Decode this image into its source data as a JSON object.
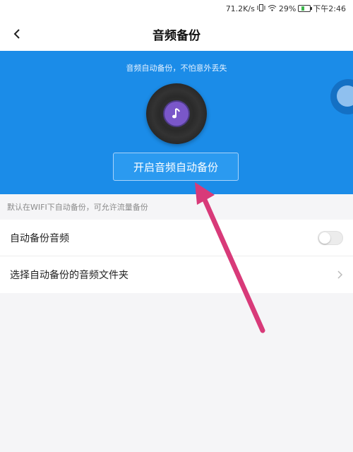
{
  "status_bar": {
    "speed": "71.2K/s",
    "battery_percent": "29%",
    "battery_level": 0.29,
    "time": "下午2:46"
  },
  "header": {
    "title": "音频备份"
  },
  "hero": {
    "subtitle": "音频自动备份，不怕意外丢失",
    "start_button_label": "开启音频自动备份"
  },
  "hint": "默认在WIFI下自动备份，可允许流量备份",
  "settings": {
    "auto_backup_label": "自动备份音频",
    "auto_backup_enabled": false,
    "select_folder_label": "选择自动备份的音频文件夹"
  },
  "colors": {
    "hero_background": "#1b8ce8",
    "annotation_arrow": "#d83a79"
  },
  "icons": {
    "back": "back-arrow-icon",
    "music": "music-note-icon",
    "chevron": "chevron-right-icon"
  }
}
